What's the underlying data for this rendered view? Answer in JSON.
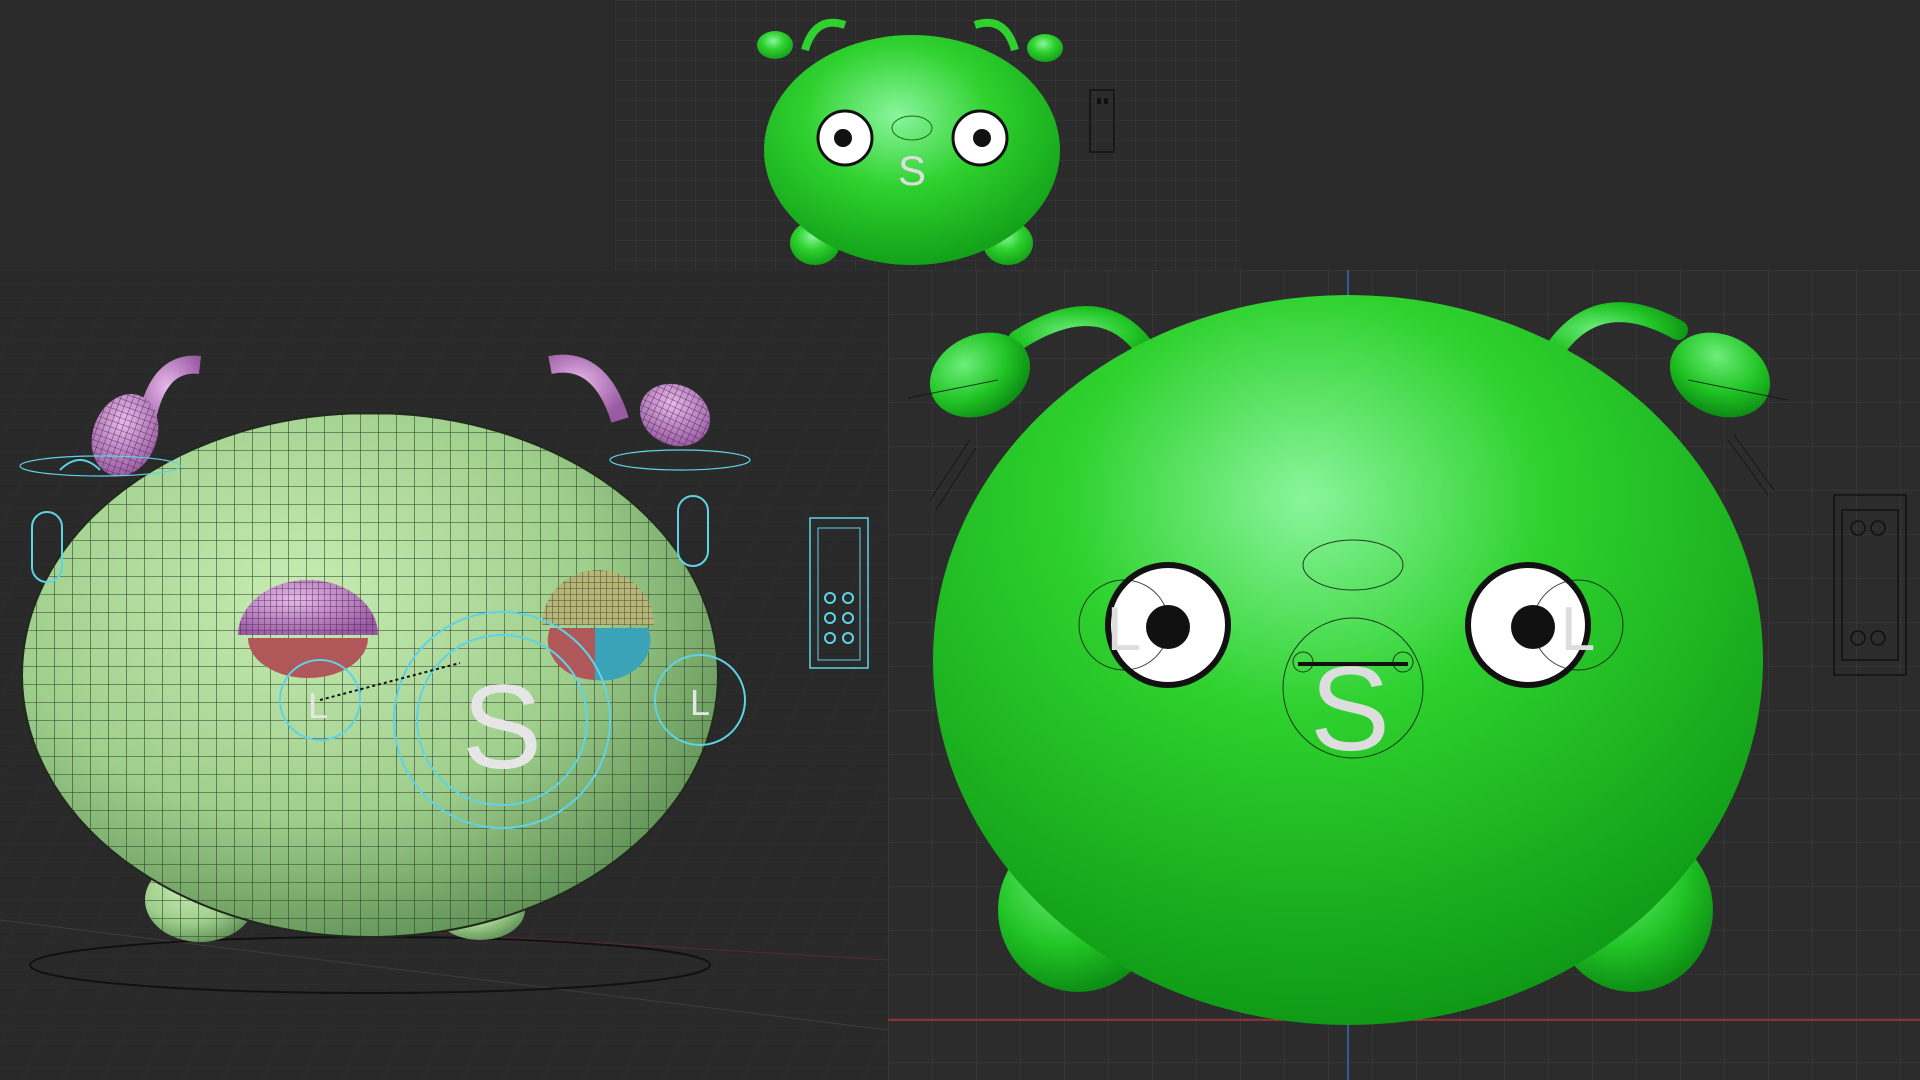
{
  "app": {
    "window_title": "",
    "background_color": "#2a2a2a"
  },
  "character": {
    "body_color": "#2ed12e",
    "highlight_color": "#8af59c",
    "shadow_color": "#0f9a16",
    "wire_body_color": "#9fcf8c",
    "wire_antenna_color": "#c88bd0",
    "eye_white": "#ffffff",
    "pupil": "#111111"
  },
  "rig": {
    "control_color": "#5fd3e6",
    "guide_color": "#111111",
    "eye_left_label": "L",
    "eye_right_label": "L",
    "mouth_label": "S"
  },
  "viewports": {
    "top_preview": {
      "mode": "shaded"
    },
    "perspective": {
      "mode": "wireframe-on-shaded"
    },
    "front": {
      "mode": "shaded"
    }
  },
  "axis": {
    "x_color": "#c83232",
    "y_color": "#3a7bd5"
  },
  "icons": {
    "selector_panel": "controller-panel-icon"
  }
}
